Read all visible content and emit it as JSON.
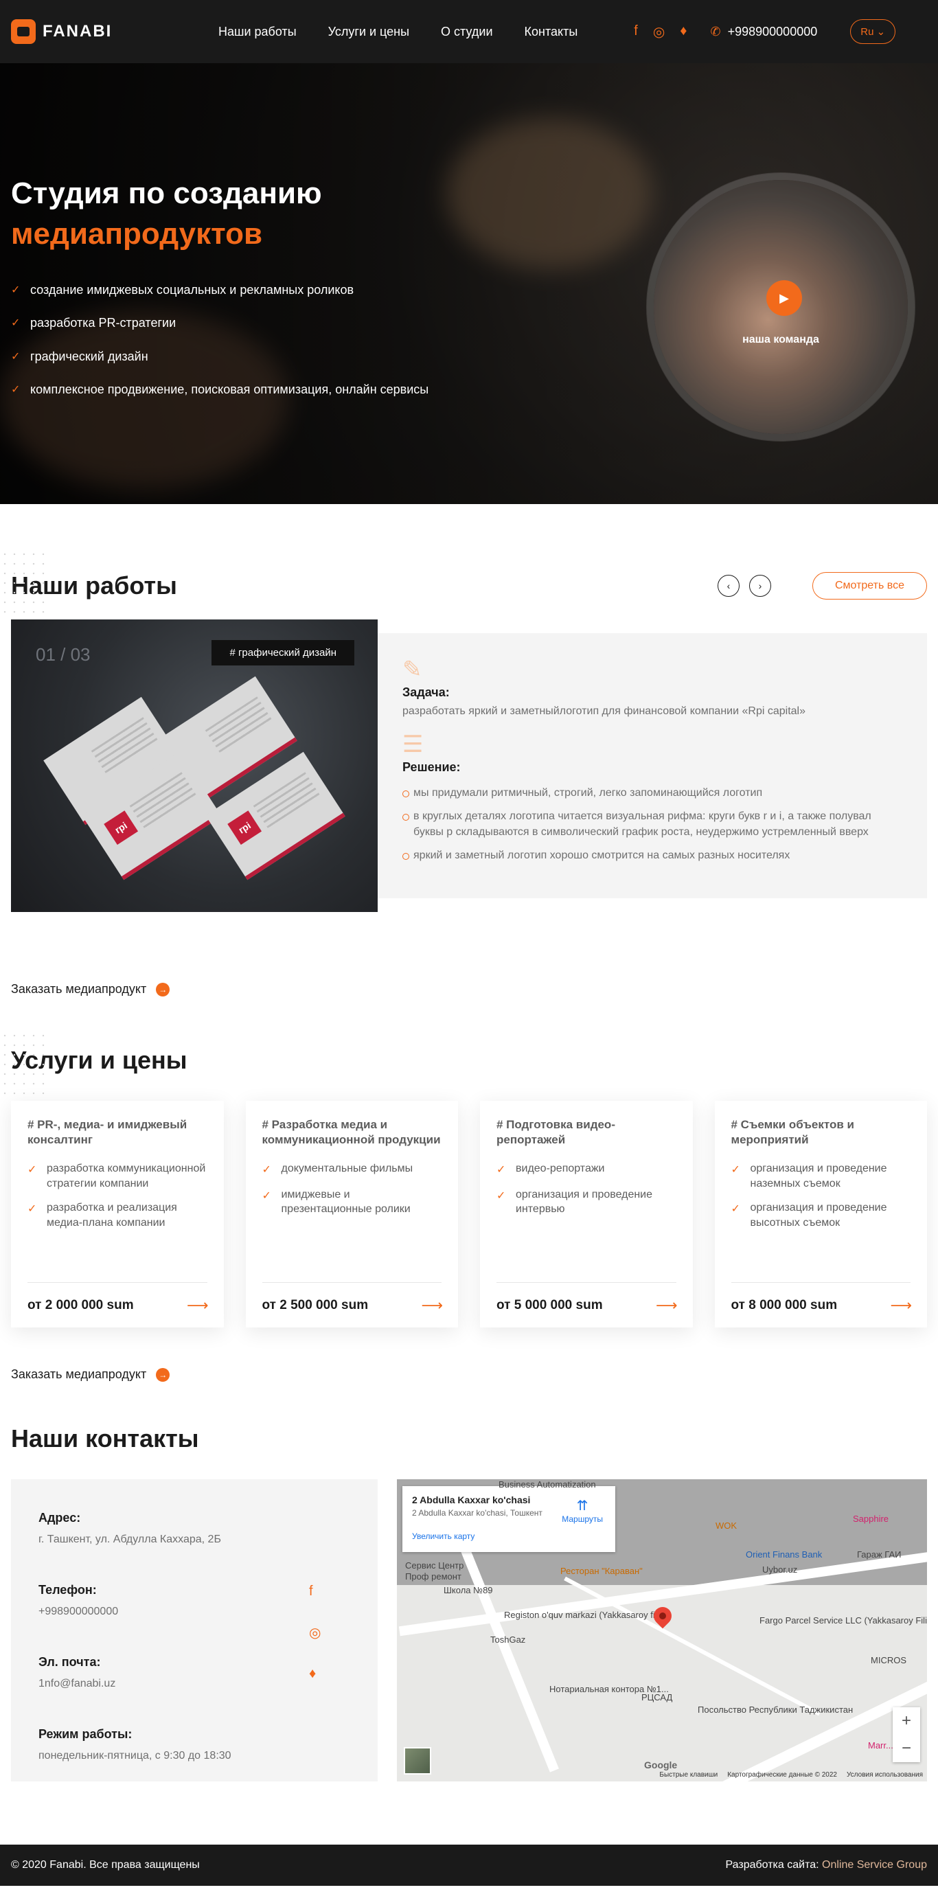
{
  "header": {
    "logo_text": "FANABI",
    "nav": [
      "Наши работы",
      "Услуги и цены",
      "О студии",
      "Контакты"
    ],
    "social_icons": [
      "facebook-icon",
      "instagram-icon",
      "twitter-icon"
    ],
    "phone": "+998900000000",
    "lang": "Ru"
  },
  "hero": {
    "title": "Студия по созданию",
    "title_accent": "медиапродуктов",
    "items": [
      "создание имиджевых социальных и рекламных роликов",
      "разработка PR-стратегии",
      "графический дизайн",
      "комплексное продвижение, поисковая оптимизация, онлайн сервисы"
    ],
    "team_label": "наша команда"
  },
  "works": {
    "title": "Наши работы",
    "see_all": "Смотреть все",
    "counter": "01 / 03",
    "tag": "# графический дизайн",
    "task_label": "Задача:",
    "task_text": "разработать яркий и заметныйлоготип для финансовой компании «Rpi capital»",
    "solution_label": "Решение:",
    "solutions": [
      "мы придумали ритмичный, строгий, легко запоминающийся логотип",
      "в круглых деталях логотипа читается визуальная рифма: круги букв r и i, а также полувал буквы p складываются в символический график роста, неудержимо устремленный вверх",
      "яркий и заметный логотип хорошо смотрится на самых разных носителях"
    ],
    "card_text": "rpi"
  },
  "order_label": "Заказать медиапродукт",
  "services": {
    "title": "Услуги и цены",
    "cards": [
      {
        "title": "# PR-, медиа- и имиджевый консалтинг",
        "items": [
          "разработка коммуникационной стратегии компании",
          "разработка и реализация медиа-плана компании"
        ],
        "price": "от 2 000 000 sum"
      },
      {
        "title": "# Разработка медиа и коммуникационной продукции",
        "items": [
          "документальные фильмы",
          "имиджевые и презентационные ролики"
        ],
        "price": "от 2 500 000 sum"
      },
      {
        "title": "# Подготовка видео-репортажей",
        "items": [
          "видео-репортажи",
          "организация и проведение интервью"
        ],
        "price": "от 5 000 000 sum"
      },
      {
        "title": "# Съемки объектов и мероприятий",
        "items": [
          "организация и проведение наземных съемок",
          "организация и проведение высотных съемок"
        ],
        "price": "от 8 000 000 sum"
      }
    ]
  },
  "contacts": {
    "title": "Наши контакты",
    "address_label": "Адрес:",
    "address": "г. Ташкент, ул. Абдулла Каххара, 2Б",
    "phone_label": "Телефон:",
    "phone": "+998900000000",
    "email_label": "Эл. почта:",
    "email": "1nfo@fanabi.uz",
    "hours_label": "Режим работы:",
    "hours": "понедельник-пятница, с 9:30 до 18:30"
  },
  "map": {
    "card_title": "2 Abdulla Kaxxar ko'chasi",
    "card_sub": "2 Abdulla Kaxxar ko'chasi, Тошкент",
    "enlarge": "Увеличить карту",
    "routes": "Маршруты",
    "pois": {
      "business": "Business Automatization",
      "service_center": "Сервис Центр",
      "prof_remont": "Проф ремонт",
      "wok": "WOK",
      "orient": "Orient Finans Bank",
      "sapphire": "Sapphire",
      "garage": "Гараж ГАИ",
      "uybor": "Uybor.uz",
      "karavan": "Ресторан \"Караван\"",
      "school": "Школа №89",
      "registon": "Registon o'quv markazi (Yakkasaroy filiali)",
      "fargo": "Fargo Parcel Service LLC (Yakkasaroy Filial)",
      "toshgaz": "ToshGaz",
      "micros": "MICROS",
      "notary": "Нотариальная контора №1...",
      "rcad": "РЦСАД",
      "embassy": "Посольство Республики Таджикистан",
      "marr": "Marr..."
    },
    "google": "Google",
    "footer_links": [
      "Быстрые клавиши",
      "Картографические данные © 2022",
      "Условия использования"
    ],
    "zoom_in": "+",
    "zoom_out": "−"
  },
  "footer": {
    "copyright": "© 2020 Fanabi. Все права защищены",
    "dev_prefix": "Разработка сайта:",
    "dev_company": "Online Service Group"
  },
  "colors": {
    "accent": "#f26a1b",
    "dark": "#1a1a1a",
    "panel": "#f4f4f4"
  }
}
